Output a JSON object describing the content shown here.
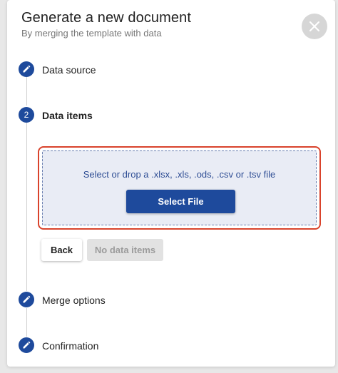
{
  "dialog": {
    "title": "Generate a new document",
    "subtitle": "By merging the template with data",
    "close_icon": "close-icon"
  },
  "steps": [
    {
      "label": "Data source",
      "marker": "pencil-icon",
      "state": "completed"
    },
    {
      "label": "Data items",
      "marker": "2",
      "state": "active"
    },
    {
      "label": "Merge options",
      "marker": "pencil-icon",
      "state": "completed"
    },
    {
      "label": "Confirmation",
      "marker": "pencil-icon",
      "state": "completed"
    }
  ],
  "dropzone": {
    "text": "Select or drop a .xlsx, .xls, .ods, .csv or .tsv file",
    "button_label": "Select File"
  },
  "actions": {
    "back_label": "Back",
    "next_label": "No data items",
    "next_disabled": true
  },
  "colors": {
    "primary": "#1e4a9c",
    "highlight_border": "#d9432c",
    "dropzone_bg": "#e9ecf5",
    "disabled_bg": "#e2e2e2"
  }
}
